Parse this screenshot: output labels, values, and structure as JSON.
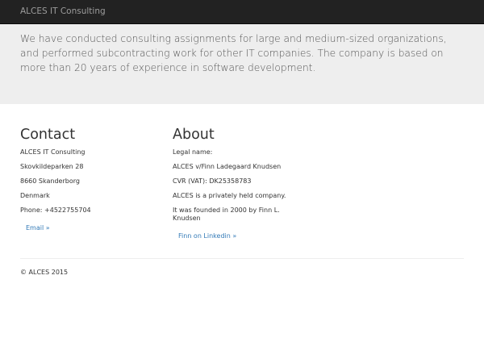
{
  "navbar": {
    "brand": "ALCES IT Consulting"
  },
  "jumbotron": {
    "lead": "We have conducted consulting assignments for large and medium-sized organizations, and performed subcontracting work for other IT companies. The company is based on more than 20 years of experience in software development."
  },
  "contact": {
    "heading": "Contact",
    "lines": [
      "ALCES IT Consulting",
      "Skovkildeparken 28",
      "8660 Skanderborg",
      "Denmark",
      "Phone: +4522755704"
    ],
    "email_link": "Email »"
  },
  "about": {
    "heading": "About",
    "lines": [
      "Legal name:",
      "ALCES v/Finn Ladegaard Knudsen",
      "CVR (VAT): DK25358783",
      "ALCES is a privately held company.",
      "It was founded in 2000 by Finn L. Knudsen"
    ],
    "linkedin_link": "Finn on Linkedin »"
  },
  "footer": {
    "copyright": "© ALCES 2015"
  },
  "colors": {
    "navbar_bg": "#222222",
    "brand_text": "#9d9d9d",
    "jumbotron_bg": "#eeeeee",
    "link": "#337ab7"
  }
}
